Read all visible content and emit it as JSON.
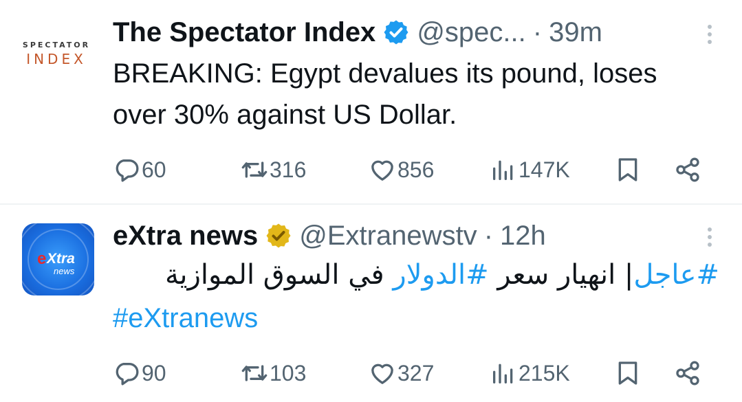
{
  "tweets": [
    {
      "avatar": {
        "line1": "SPECTATOR",
        "line2": "INDEX"
      },
      "name": "The Spectator Index",
      "verified": "blue",
      "handle": "@spec...",
      "separator": "·",
      "time": "39m",
      "text": "BREAKING: Egypt devalues its pound, loses over 30% against US Dollar.",
      "replies": "60",
      "retweets": "316",
      "likes": "856",
      "views": "147K"
    },
    {
      "avatar": {
        "logo_e": "e",
        "logo_xtra": "Xtra",
        "logo_news": "news"
      },
      "name": "eXtra news",
      "verified": "gold",
      "handle": "@Extranewstv",
      "separator": "·",
      "time": "12h",
      "text_parts": {
        "tag1": "#عاجل",
        "plain1": "| انهيار سعر ",
        "tag2": "#الدولار",
        "plain2": " في السوق الموازية"
      },
      "hashtag_line": "#eXtranews",
      "replies": "90",
      "retweets": "103",
      "likes": "327",
      "views": "215K"
    }
  ],
  "colors": {
    "accent": "#1d9bf0",
    "secondary_text": "#536471",
    "gold_badge": "#e2b719",
    "brand_orange": "#c4572a"
  }
}
